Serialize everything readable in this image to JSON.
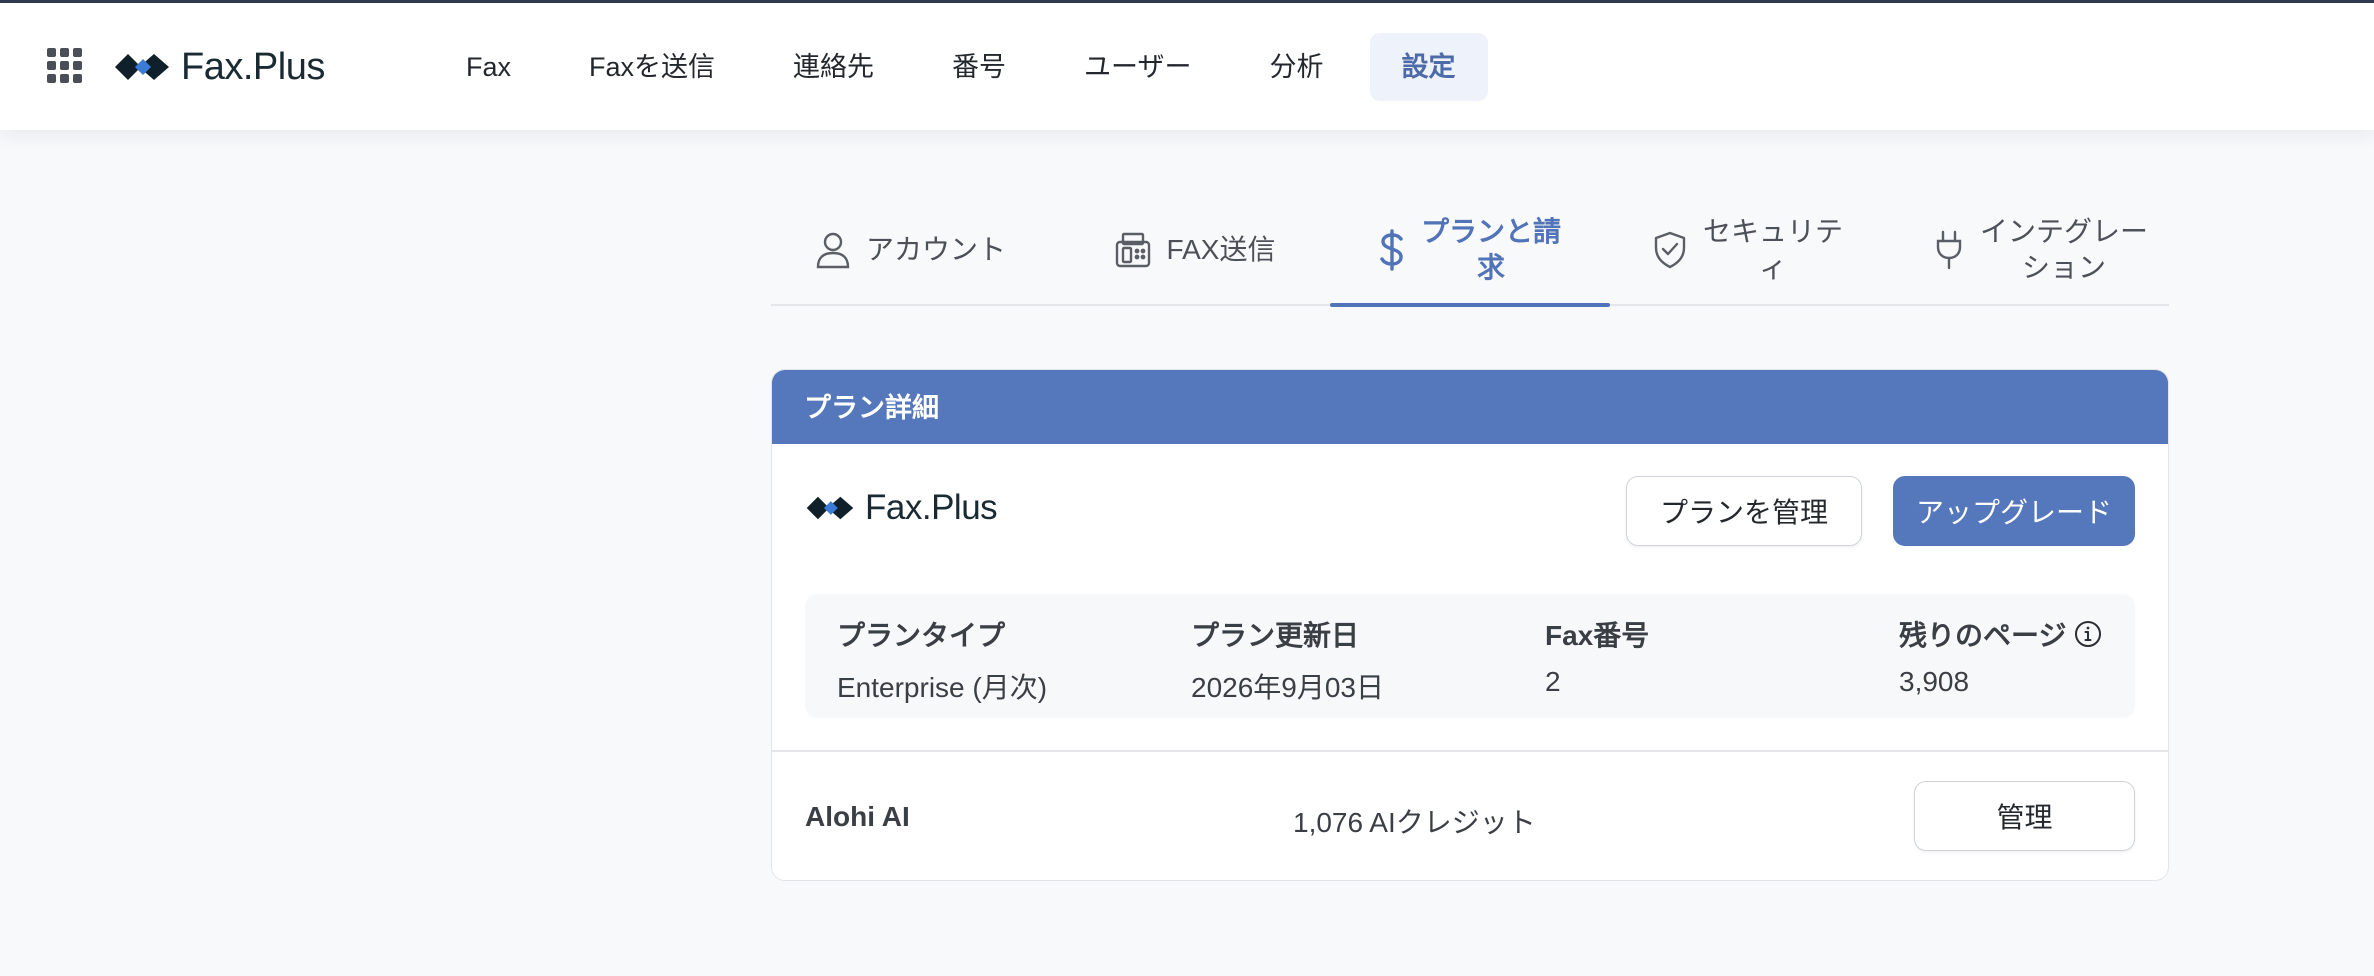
{
  "app": {
    "brand": "Fax.Plus",
    "icons": {
      "apps": "apps-grid-icon",
      "logo": "faxplus-logo-icon"
    }
  },
  "nav": {
    "items": [
      {
        "label": "Fax"
      },
      {
        "label": "Faxを送信"
      },
      {
        "label": "連絡先"
      },
      {
        "label": "番号"
      },
      {
        "label": "ユーザー"
      },
      {
        "label": "分析"
      },
      {
        "label": "設定"
      }
    ],
    "active": "設定"
  },
  "tabs": {
    "items": [
      {
        "label": "アカウント",
        "icon": "user-icon"
      },
      {
        "label": "FAX送信",
        "icon": "fax-machine-icon"
      },
      {
        "label_line1": "プランと請",
        "label_line2": "求",
        "icon": "dollar-icon"
      },
      {
        "label_line1": "セキュリテ",
        "label_line2": "ィ",
        "icon": "shield-check-icon"
      },
      {
        "label_line1": "インテグレー",
        "label_line2": "ション",
        "icon": "plug-icon"
      }
    ],
    "active_index": 2
  },
  "plan_card": {
    "header": "プラン詳細",
    "brand": "Fax.Plus",
    "manage_plan_label": "プランを管理",
    "upgrade_label": "アップグレード",
    "details": {
      "plan_type": {
        "label": "プランタイプ",
        "value": "Enterprise (月次)"
      },
      "renewal_date": {
        "label": "プラン更新日",
        "value": "2026年9月03日"
      },
      "fax_numbers": {
        "label": "Fax番号",
        "value": "2"
      },
      "remaining_pages": {
        "label": "残りのページ",
        "value": "3,908",
        "icon": "info-icon"
      }
    },
    "ai": {
      "label": "Alohi AI",
      "credits": "1,076 AIクレジット",
      "manage_label": "管理"
    }
  },
  "colors": {
    "accent": "#5577bb",
    "active_tab": "#5173b8",
    "nav_active_bg": "#eef2fa",
    "page_bg": "#f8f9fb"
  }
}
